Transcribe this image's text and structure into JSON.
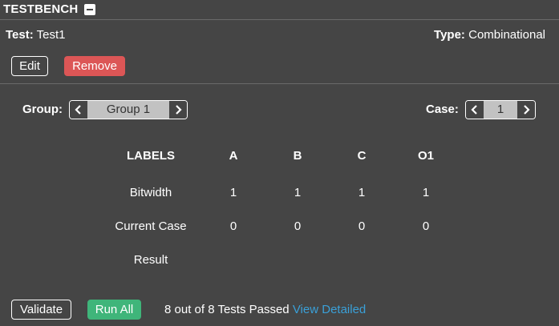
{
  "header": {
    "title": "TESTBENCH"
  },
  "test": {
    "label": "Test:",
    "name": "Test1"
  },
  "type": {
    "label": "Type:",
    "value": "Combinational"
  },
  "actions": {
    "edit": "Edit",
    "remove": "Remove"
  },
  "group": {
    "label": "Group:",
    "value": "Group 1"
  },
  "case": {
    "label": "Case:",
    "value": "1"
  },
  "table": {
    "header": [
      "LABELS",
      "A",
      "B",
      "C",
      "O1"
    ],
    "bitwidth": [
      "Bitwidth",
      "1",
      "1",
      "1",
      "1"
    ],
    "current_case": [
      "Current Case",
      "0",
      "0",
      "0",
      "0"
    ],
    "result": [
      "Result"
    ]
  },
  "footer": {
    "validate": "Validate",
    "run_all": "Run All",
    "status": "8 out of 8 Tests Passed",
    "view_detailed": "View Detailed"
  },
  "colors": {
    "background": "#454545",
    "remove": "#dc5656",
    "run_all": "#3fb57a",
    "link": "#3aa0d8",
    "selector_value": "#c2c2c2"
  }
}
